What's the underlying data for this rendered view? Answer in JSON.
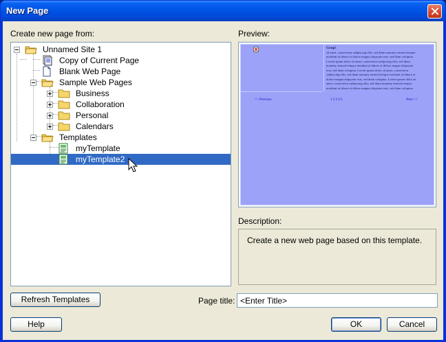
{
  "window": {
    "title": "New Page"
  },
  "labels": {
    "create_from": "Create new page from:",
    "preview": "Preview:",
    "description": "Description:",
    "page_title": "Page title:"
  },
  "tree": {
    "items": [
      {
        "label": "Unnamed Site 1",
        "icon": "folder-open-icon",
        "expander": "minus"
      },
      {
        "label": "Copy of Current Page",
        "icon": "copy-page-icon"
      },
      {
        "label": "Blank Web Page",
        "icon": "blank-page-icon"
      },
      {
        "label": "Sample Web Pages",
        "icon": "folder-open-icon",
        "expander": "minus"
      },
      {
        "label": "Business",
        "icon": "folder-icon",
        "expander": "plus"
      },
      {
        "label": "Collaboration",
        "icon": "folder-icon",
        "expander": "plus"
      },
      {
        "label": "Personal",
        "icon": "folder-icon",
        "expander": "plus"
      },
      {
        "label": "Calendars",
        "icon": "folder-icon",
        "expander": "plus"
      },
      {
        "label": "Templates",
        "icon": "folder-open-icon",
        "expander": "minus"
      },
      {
        "label": "myTemplate",
        "icon": "template-icon"
      },
      {
        "label": "myTemplate2",
        "icon": "template-icon",
        "selected": true
      }
    ]
  },
  "preview": {
    "heading": "Grup!",
    "body": "sit amet, consectetur sadipscing elitr, sed diam nonumy eirmod tempor invidunt ut labore et dolore magna aliquyam erat, sed diam voluptua. Lorem ipsum dolor sit amet, consectetur sadipscing elitr, sed diam nonumy eirmod tempor invidunt ut labore et dolore magna aliquyam erat, sed diam voluptua. Lorem ipsum dolor sit amet, consectetur sadipscing elitr, sed diam nonumy eirmod tempor invidunt ut labore et dolore magna aliquyam erat, sed diam voluptua. Lorem ipsum dolor sit amet, consectetur sadipscing elitr, sed diam nonumy eirmod tempor invidunt ut labore et dolore magna aliquyam erat, sed diam voluptua.",
    "prev_link": "<< Previous",
    "pages": "1 2 3 4 5",
    "next_link": "Next >>",
    "bg_color": "#9ba2f8"
  },
  "description_text": "Create a new web page based on this template.",
  "page_title_value": "<Enter Title>",
  "buttons": {
    "refresh": "Refresh Templates",
    "help": "Help",
    "ok": "OK",
    "cancel": "Cancel"
  }
}
